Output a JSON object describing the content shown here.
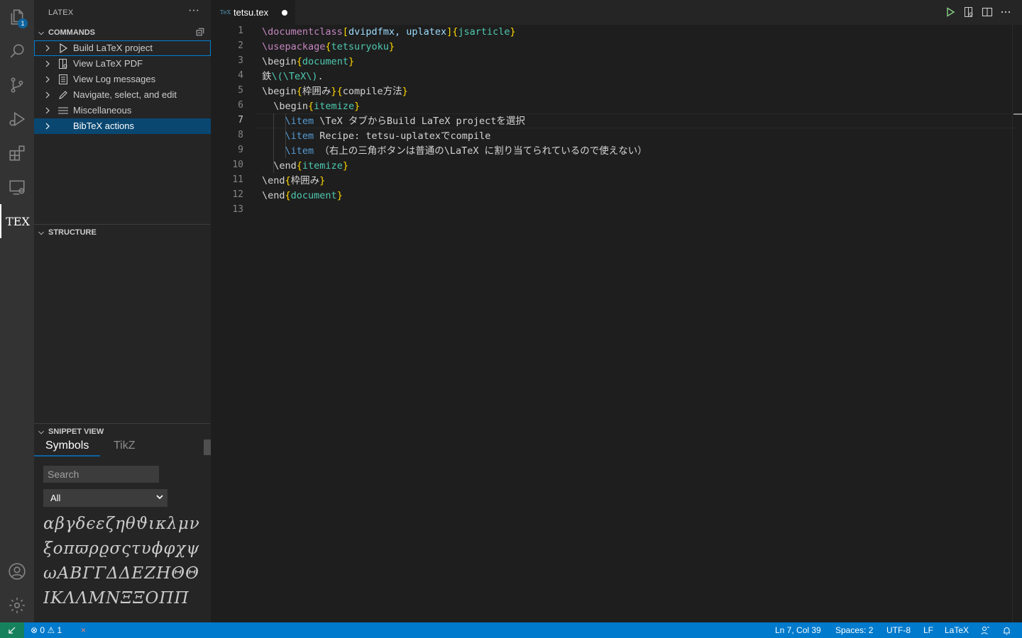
{
  "activity": {
    "explorer_badge": "1",
    "tex_label": "TEX"
  },
  "sidebar": {
    "title": "LATEX",
    "more": "···",
    "commands_header": "COMMANDS",
    "commands": [
      {
        "label": "Build LaTeX project"
      },
      {
        "label": "View LaTeX PDF"
      },
      {
        "label": "View Log messages"
      },
      {
        "label": "Navigate, select, and edit"
      },
      {
        "label": "Miscellaneous"
      },
      {
        "label": "BibTeX actions"
      }
    ],
    "structure_header": "STRUCTURE",
    "snippet_header": "SNIPPET VIEW",
    "snippet_tabs": [
      "Symbols",
      "TikZ"
    ],
    "search_placeholder": "Search",
    "select_value": "All",
    "symbols": "αβγδϵεζηθϑικλμνξοπϖρϱσςτυϕφχψωΑΒΓΓΔΔΕΖΗΘΘΙΚΛΛΜΝΞΞΟΠΠ"
  },
  "editor": {
    "tab_label": "tetsu.tex",
    "tab_icon": "TeX",
    "lines": [
      [
        [
          "kw",
          "\\documentclass"
        ],
        [
          "br",
          "["
        ],
        [
          "ar",
          "dvipdfmx, uplatex"
        ],
        [
          "br",
          "]"
        ],
        [
          "br",
          "{"
        ],
        [
          "tl",
          "jsarticle"
        ],
        [
          "br",
          "}"
        ]
      ],
      [
        [
          "kw",
          "\\usepackage"
        ],
        [
          "br",
          "{"
        ],
        [
          "tl",
          "tetsuryoku"
        ],
        [
          "br",
          "}"
        ]
      ],
      [
        [
          "tx",
          "\\begin"
        ],
        [
          "br",
          "{"
        ],
        [
          "tl",
          "document"
        ],
        [
          "br",
          "}"
        ]
      ],
      [
        [
          "tx",
          "鉄"
        ],
        [
          "tl",
          "\\(\\TeX\\)"
        ],
        [
          "tx",
          "."
        ]
      ],
      [
        [
          "tx",
          "\\begin"
        ],
        [
          "br",
          "{"
        ],
        [
          "tx",
          "枠囲み"
        ],
        [
          "br",
          "}"
        ],
        [
          "br",
          "{"
        ],
        [
          "tx",
          "compile方法"
        ],
        [
          "br",
          "}"
        ]
      ],
      [
        [
          "tx",
          "  \\begin"
        ],
        [
          "br",
          "{"
        ],
        [
          "tl",
          "itemize"
        ],
        [
          "br",
          "}"
        ]
      ],
      [
        [
          "tx",
          "    "
        ],
        [
          "bl",
          "\\item"
        ],
        [
          "tx",
          " \\TeX タブからBuild LaTeX projectを選択"
        ]
      ],
      [
        [
          "tx",
          "    "
        ],
        [
          "bl",
          "\\item"
        ],
        [
          "tx",
          " Recipe: tetsu-uplatexでcompile"
        ]
      ],
      [
        [
          "tx",
          "    "
        ],
        [
          "bl",
          "\\item"
        ],
        [
          "tx",
          " （右上の三角ボタンは普通の\\LaTeX に割り当てられているので使えない）"
        ]
      ],
      [
        [
          "tx",
          "  \\end"
        ],
        [
          "br",
          "{"
        ],
        [
          "tl",
          "itemize"
        ],
        [
          "br",
          "}"
        ]
      ],
      [
        [
          "tx",
          "\\end"
        ],
        [
          "br",
          "{"
        ],
        [
          "tx",
          "枠囲み"
        ],
        [
          "br",
          "}"
        ]
      ],
      [
        [
          "tx",
          "\\end"
        ],
        [
          "br",
          "{"
        ],
        [
          "tl",
          "document"
        ],
        [
          "br",
          "}"
        ]
      ],
      [
        [
          "tx",
          ""
        ]
      ]
    ],
    "current_line": 7
  },
  "status": {
    "errors": "0",
    "warnings": "1",
    "position": "Ln 7, Col 39",
    "spaces": "Spaces: 2",
    "encoding": "UTF-8",
    "eol": "LF",
    "language": "LaTeX"
  },
  "colors": {
    "accent": "#007acc",
    "remote": "#16825d",
    "selection": "#094771"
  }
}
